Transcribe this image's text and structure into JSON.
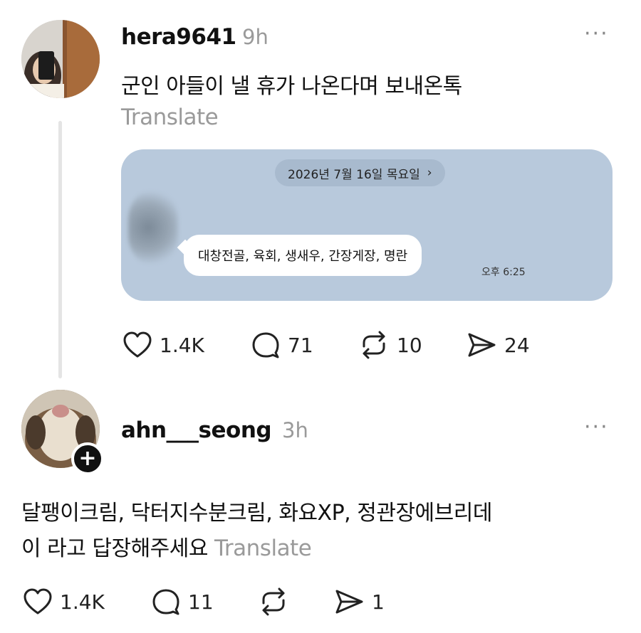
{
  "posts": [
    {
      "username": "hera9641",
      "time": "9h",
      "more": "···",
      "text": "군인 아들이 낼 휴가 나온다며 보내온톡",
      "translate": "Translate",
      "screenshot": {
        "date": "2026년 7월 16일 목요일",
        "date_chevron": "›",
        "message": "대창전골, 육회, 생새우, 간장게장, 명란",
        "message_time": "오후 6:25"
      },
      "actions": {
        "likes": "1.4K",
        "comments": "71",
        "reposts": "10",
        "shares": "24"
      }
    },
    {
      "username": "ahn___seong",
      "time": "3h",
      "more": "···",
      "follow": "+",
      "text_line1": "달팽이크림, 닥터지수분크림, 화요XP, 정관장에브리데",
      "text_line2": "이 라고 답장해주세요",
      "translate": "Translate",
      "actions": {
        "likes": "1.4K",
        "comments": "11",
        "reposts": "",
        "shares": "1"
      }
    }
  ],
  "icons": {
    "like": "heart-icon",
    "comment": "comment-bubble-icon",
    "repost": "repost-icon",
    "share": "send-icon",
    "more": "more-dots-icon",
    "follow": "plus-icon"
  }
}
